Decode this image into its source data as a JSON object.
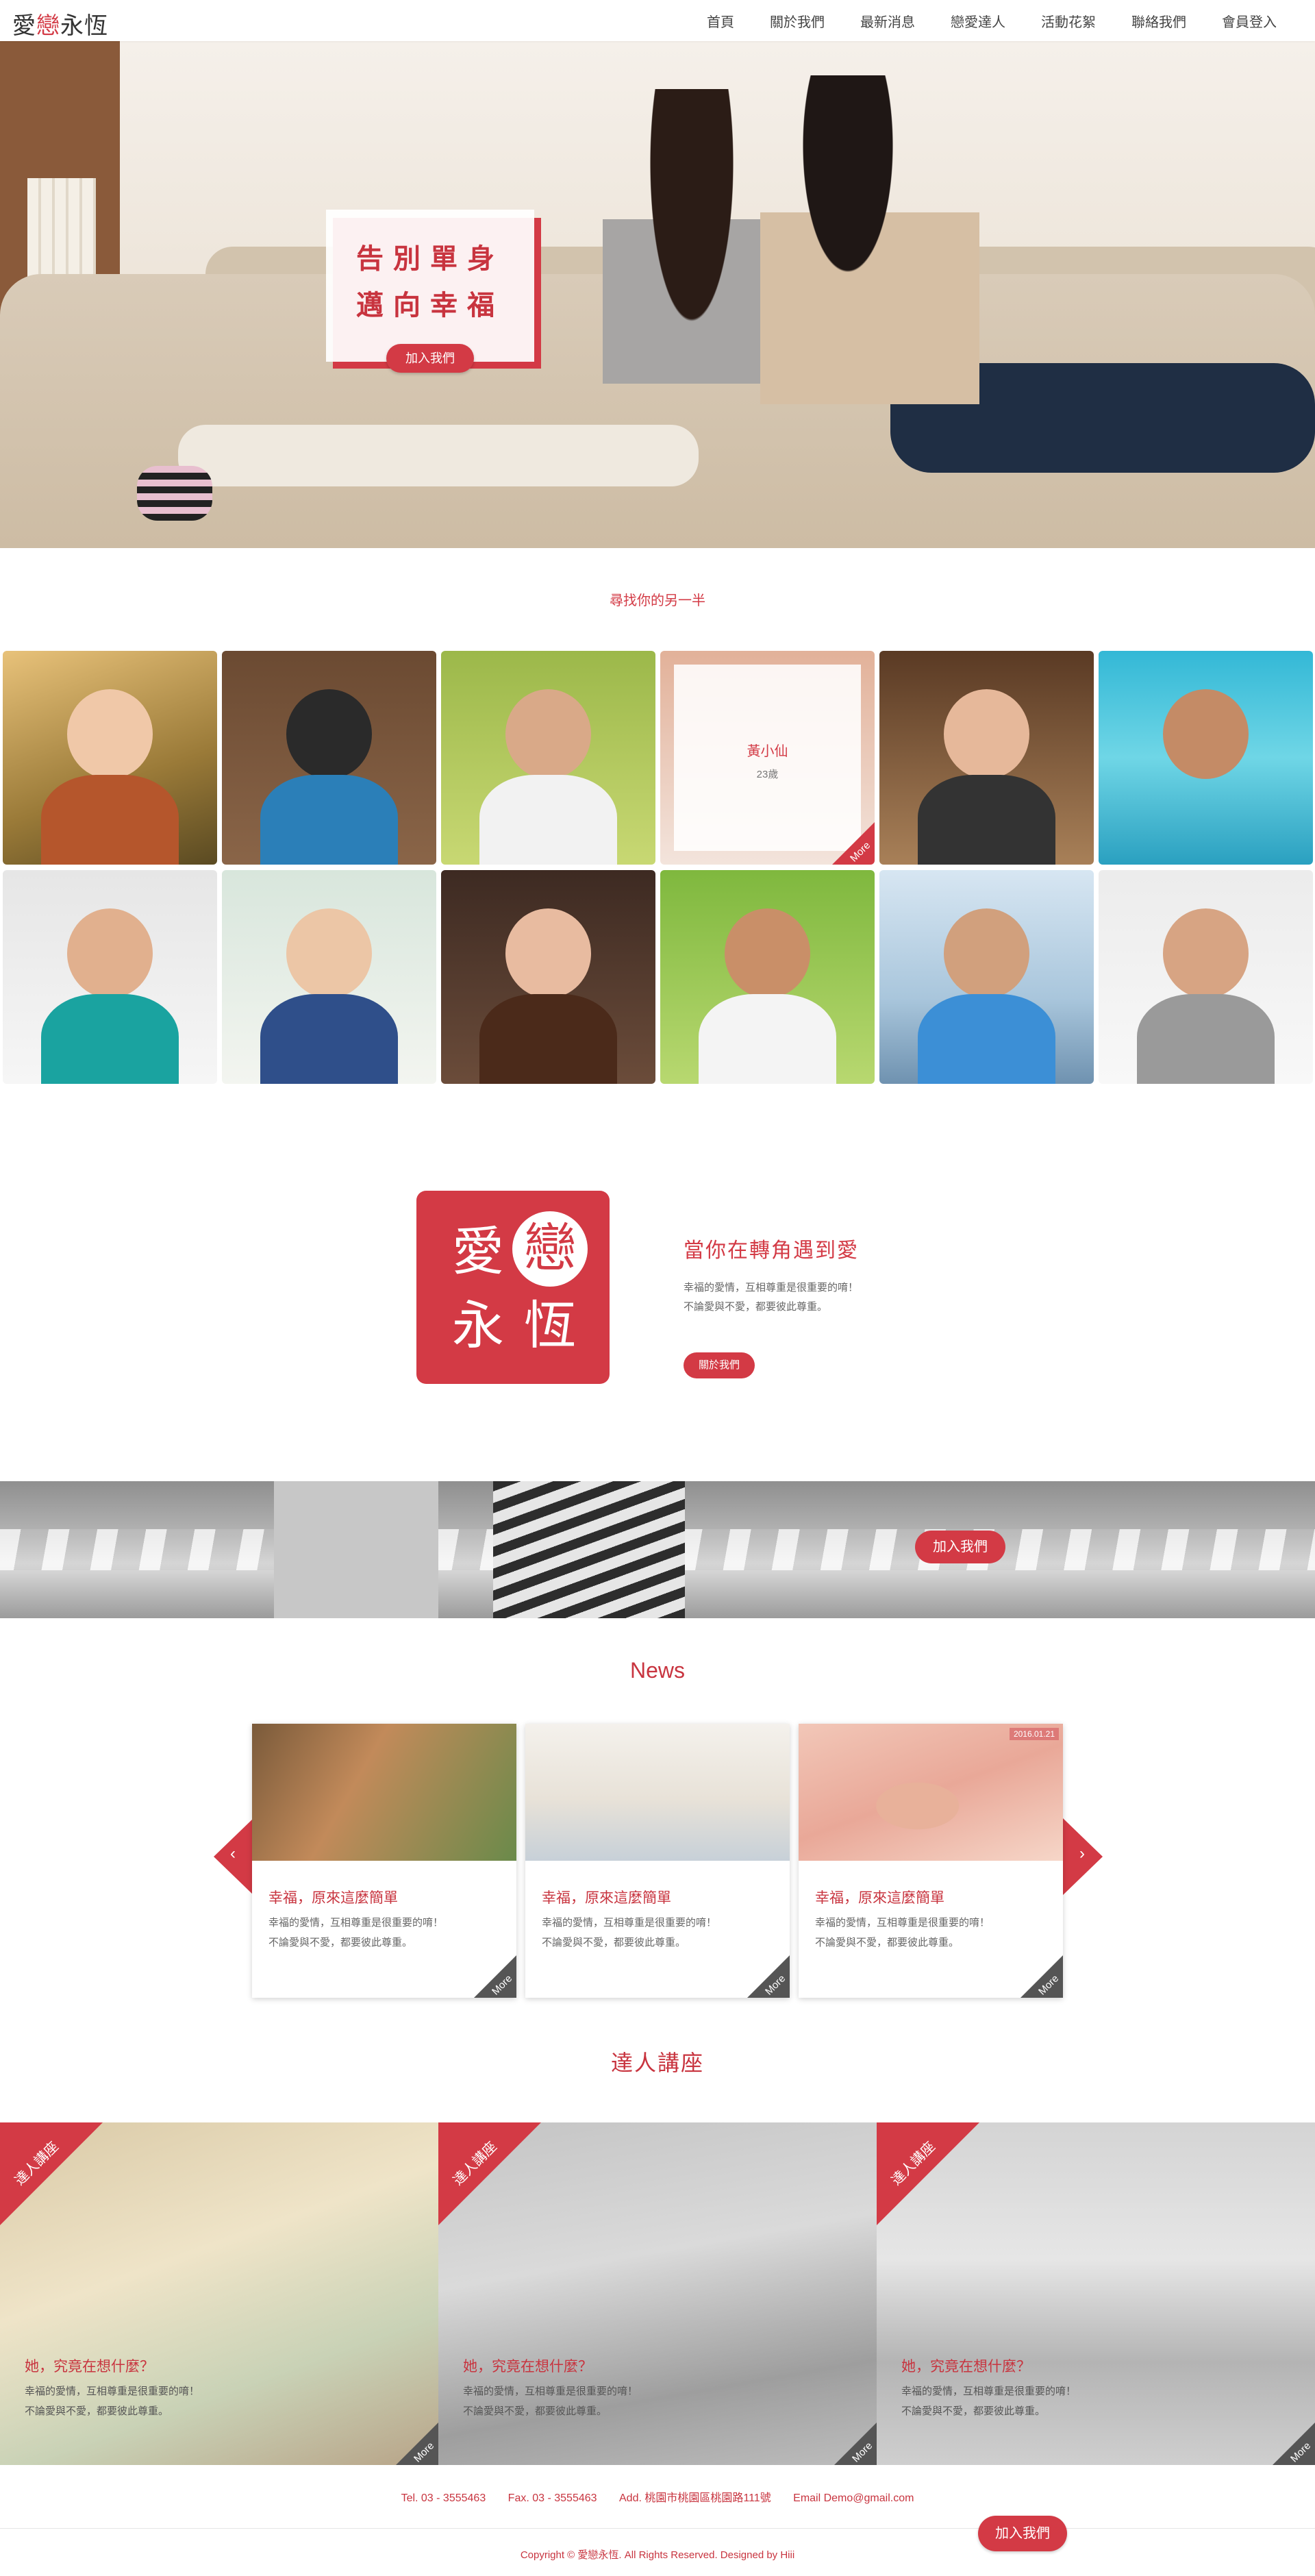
{
  "brand": {
    "part1": "愛",
    "accent": "戀",
    "part2": "永恆",
    "accent_color": "#d33a45"
  },
  "nav": {
    "items": [
      "首頁",
      "關於我們",
      "最新消息",
      "戀愛達人",
      "活動花絮",
      "聯絡我們",
      "會員登入"
    ]
  },
  "hero": {
    "line1": "告別單身",
    "line2": "邁向幸福",
    "button": "加入我們"
  },
  "find": {
    "title": "尋找你的另一半"
  },
  "profiles": [
    {
      "image": "woman-dandelion-photo"
    },
    {
      "image": "woman-camera-photo"
    },
    {
      "image": "man-smiling-photo"
    },
    {
      "image": "woman-portrait-photo",
      "name": "黃小仙",
      "age": "23歲",
      "more": "More"
    },
    {
      "image": "woman-bakery-photo"
    },
    {
      "image": "man-swimming-photo"
    },
    {
      "image": "woman-teal-shirt-photo"
    },
    {
      "image": "woman-overalls-photo"
    },
    {
      "image": "woman-coffee-photo"
    },
    {
      "image": "man-backpack-photo"
    },
    {
      "image": "man-pier-photo"
    },
    {
      "image": "man-closeup-photo"
    }
  ],
  "about": {
    "logo_chars": [
      "愛",
      "戀",
      "永",
      "恆"
    ],
    "title": "當你在轉角遇到愛",
    "desc_lines": [
      "幸福的愛情，互相尊重是很重要的唷！",
      "不論愛與不愛，都要彼此尊重。"
    ],
    "button": "關於我們"
  },
  "banner": {
    "button": "加入我們"
  },
  "news": {
    "title": "News",
    "items": [
      {
        "image": "couple-street-photo",
        "title": "幸福，原來這麼簡單",
        "lines": [
          "幸福的愛情，互相尊重是很重要的唷！",
          "不論愛與不愛，都要彼此尊重。"
        ],
        "more": "More"
      },
      {
        "image": "woman-beach-photo",
        "title": "幸福，原來這麼簡單",
        "lines": [
          "幸福的愛情，互相尊重是很重要的唷！",
          "不論愛與不愛，都要彼此尊重。"
        ],
        "more": "More"
      },
      {
        "image": "wedding-rings-photo",
        "date": "2016.01.21",
        "title": "幸福，原來這麼簡單",
        "lines": [
          "幸福的愛情，互相尊重是很重要的唷！",
          "不論愛與不愛，都要彼此尊重。"
        ],
        "more": "More"
      }
    ]
  },
  "lecture": {
    "title": "達人講座",
    "items": [
      {
        "ribbon": "達人講座",
        "title": "她，究竟在想什麼？",
        "lines": [
          "幸福的愛情，互相尊重是很重要的唷！",
          "不論愛與不愛，都要彼此尊重。"
        ],
        "more": "More"
      },
      {
        "ribbon": "達人講座",
        "title": "她，究竟在想什麼？",
        "lines": [
          "幸福的愛情，互相尊重是很重要的唷！",
          "不論愛與不愛，都要彼此尊重。"
        ],
        "more": "More"
      },
      {
        "ribbon": "達人講座",
        "title": "她，究竟在想什麼？",
        "lines": [
          "幸福的愛情，互相尊重是很重要的唷！",
          "不論愛與不愛，都要彼此尊重。"
        ],
        "more": "More"
      }
    ]
  },
  "footer": {
    "tel": "Tel.  03 - 3555463",
    "fax": "Fax.  03 - 3555463",
    "address": "Add.  桃園市桃園區桃園路111號",
    "email": "Email   Demo@gmail.com",
    "copyright": "Copyright © 愛戀永恆. All Rights Reserved. Designed by Hiii",
    "button": "加入我們"
  }
}
